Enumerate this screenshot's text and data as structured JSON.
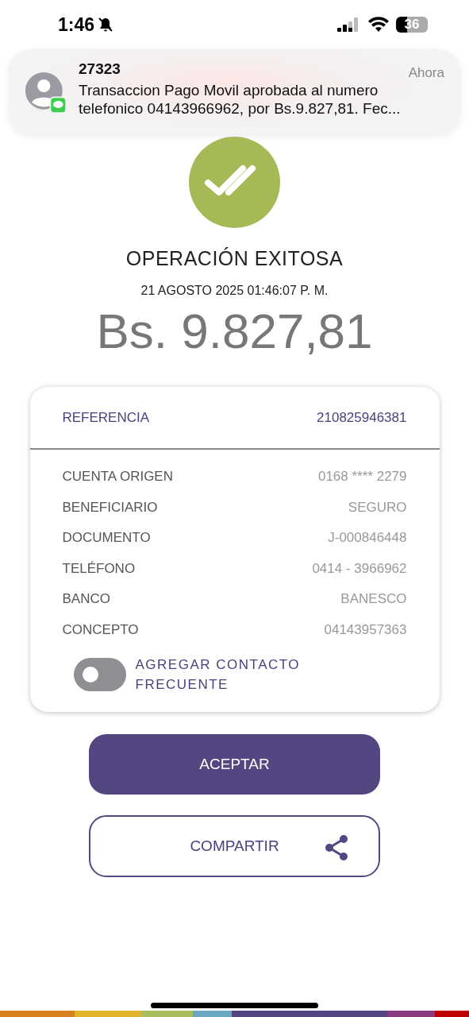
{
  "status_bar": {
    "time": "1:46",
    "battery": "36"
  },
  "notification": {
    "sender": "27323",
    "time": "Ahora",
    "message": "Transaccion Pago Movil aprobada al numero telefonico 04143966962, por Bs.9.827,81. Fec..."
  },
  "result": {
    "title": "OPERACIÓN EXITOSA",
    "date": "21 AGOSTO 2025 01:46:07 P. M.",
    "amount": "Bs. 9.827,81"
  },
  "reference": {
    "label": "REFERENCIA",
    "value": "210825946381"
  },
  "details": [
    {
      "label": "CUENTA ORIGEN",
      "value": "0168 **** 2279"
    },
    {
      "label": "BENEFICIARIO",
      "value": "SEGURO"
    },
    {
      "label": "DOCUMENTO",
      "value": "J-000846448"
    },
    {
      "label": "TELÉFONO",
      "value": "0414 - 3966962"
    },
    {
      "label": "BANCO",
      "value": "BANESCO"
    },
    {
      "label": "CONCEPTO",
      "value": "04143957363"
    }
  ],
  "contact_toggle": {
    "label": "AGREGAR CONTACTO FRECUENTE",
    "on": false
  },
  "buttons": [
    {
      "label": "ACEPTAR",
      "kind": "primary"
    },
    {
      "label": "COMPARTIR",
      "kind": "share"
    }
  ]
}
